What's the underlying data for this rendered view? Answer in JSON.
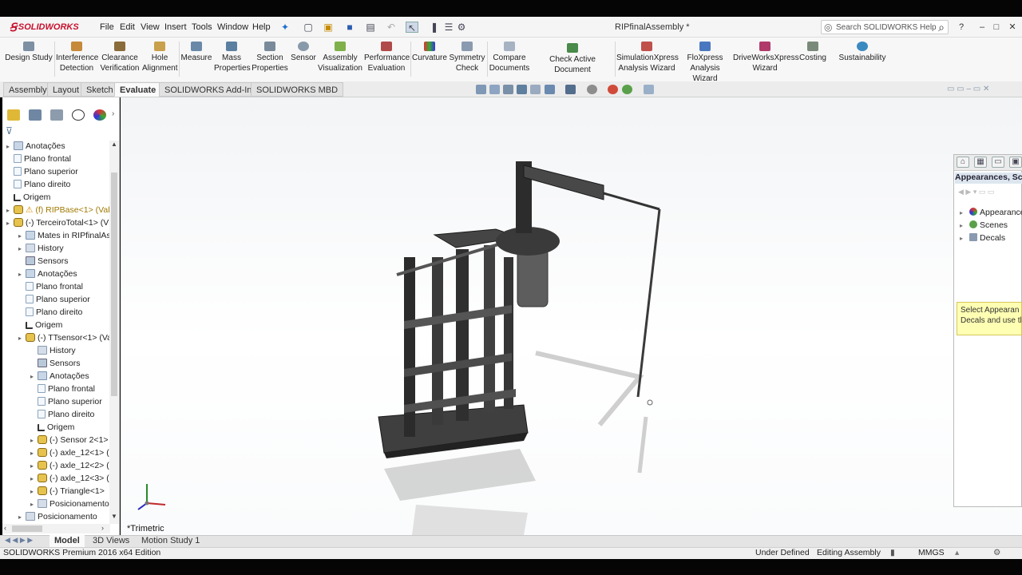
{
  "app": {
    "logo_text": "SOLIDWORKS",
    "document_title": "RIPfinalAssembly *"
  },
  "menu": [
    "File",
    "Edit",
    "View",
    "Insert",
    "Tools",
    "Window",
    "Help"
  ],
  "help_search": {
    "placeholder": "Search SOLIDWORKS Help"
  },
  "command_manager": [
    {
      "label": "Design Study",
      "icon": "design-study-icon"
    },
    {
      "label": "Interference Detection",
      "icon": "interference-icon"
    },
    {
      "label": "Clearance Verification",
      "icon": "clearance-icon"
    },
    {
      "label": "Hole Alignment",
      "icon": "hole-icon"
    },
    {
      "label": "Measure",
      "icon": "measure-icon"
    },
    {
      "label": "Mass Properties",
      "icon": "mass-icon"
    },
    {
      "label": "Section Properties",
      "icon": "section-icon"
    },
    {
      "label": "Sensor",
      "icon": "sensor-icon"
    },
    {
      "label": "Assembly Visualization",
      "icon": "asm-vis-icon"
    },
    {
      "label": "Performance Evaluation",
      "icon": "performance-icon"
    },
    {
      "label": "Curvature",
      "icon": "curvature-icon"
    },
    {
      "label": "Symmetry Check",
      "icon": "symmetry-icon"
    },
    {
      "label": "Compare Documents",
      "icon": "compare-icon"
    },
    {
      "label": "Check Active Document",
      "icon": "check-icon"
    },
    {
      "label": "SimulationXpress Analysis Wizard",
      "icon": "simxpress-icon"
    },
    {
      "label": "FloXpress Analysis Wizard",
      "icon": "floxpress-icon"
    },
    {
      "label": "DriveWorksXpress Wizard",
      "icon": "driveworks-icon"
    },
    {
      "label": "Costing",
      "icon": "costing-icon"
    },
    {
      "label": "Sustainability",
      "icon": "sustainability-icon"
    }
  ],
  "tabs": [
    "Assembly",
    "Layout",
    "Sketch",
    "Evaluate",
    "SOLIDWORKS Add-Ins",
    "SOLIDWORKS MBD"
  ],
  "active_tab": "Evaluate",
  "tree": [
    "Anotações",
    "Plano frontal",
    "Plano superior",
    "Plano direito",
    "Origem",
    "(f) RIPBase<1> (Val",
    "(-) TerceiroTotal<1> (V",
    "Mates in RIPfinalAss",
    "History",
    "Sensors",
    "Anotações",
    "Plano frontal",
    "Plano superior",
    "Plano direito",
    "Origem",
    "(-) TTsensor<1> (Va",
    "History",
    "Sensors",
    "Anotações",
    "Plano frontal",
    "Plano superior",
    "Plano direito",
    "Origem",
    "(-) Sensor 2<1>",
    "(-) axle_12<1> (",
    "(-) axle_12<2> (",
    "(-) axle_12<3> (",
    "(-) Triangle<1>",
    "Posicionamento",
    "Posicionamento"
  ],
  "viewport": {
    "view_label": "*Trimetric"
  },
  "task_pane": {
    "title": "Appearances, Scenes",
    "items": [
      "Appearances",
      "Scenes",
      "Decals"
    ],
    "note_line1": "Select Appearan",
    "note_line2": "Decals and use th"
  },
  "bottom_tabs": [
    "Model",
    "3D Views",
    "Motion Study 1"
  ],
  "status": {
    "edition": "SOLIDWORKS Premium 2016 x64 Edition",
    "state": "Under Defined",
    "mode": "Editing Assembly",
    "units": "MMGS"
  },
  "colors": {
    "brand": "#c8102e",
    "accent": "#e6c34e",
    "note_bg": "#ffffb3"
  }
}
